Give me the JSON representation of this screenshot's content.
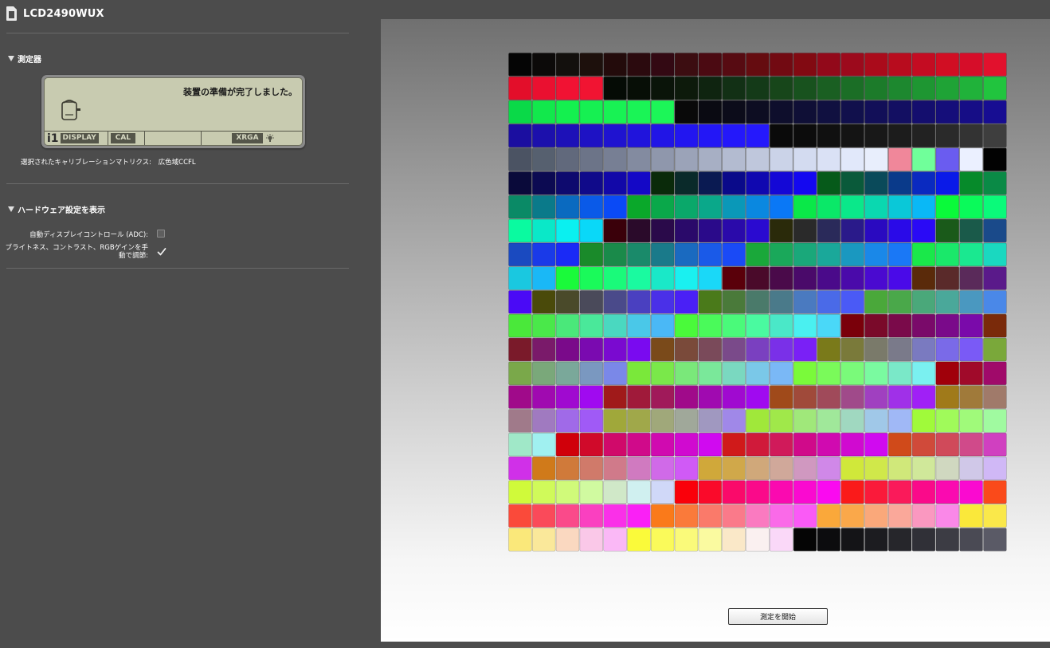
{
  "window": {
    "device_title": "LCD2490WUX"
  },
  "measurement_section": {
    "title": "測定器",
    "lcd": {
      "message": "装置の準備が完了しました。",
      "tab_i1": "i1",
      "tab_display": "DISPLAY",
      "tab_cal": "CAL",
      "tab_xrga": "XRGA"
    },
    "matrix_label": "選択されたキャリブレーションマトリクス:",
    "matrix_value": "広色域CCFL"
  },
  "hardware_section": {
    "title": "ハードウェア設定を表示",
    "ado_label": "自動ディスプレイコントロール (ADC):",
    "ado_checked": false,
    "manual_label_line1": "ブライトネス、コントラスト、RGBゲインを手",
    "manual_label_line2": "動で調節:",
    "manual_checked": true
  },
  "main": {
    "start_button": "測定を開始"
  },
  "colors": {
    "panel_bg": "#4c4c4c",
    "lcd_bg": "#c8cbb0",
    "patch_rows": [
      [
        "#050505",
        "#0c0a09",
        "#13100d",
        "#1d100c",
        "#230b0b",
        "#2b0a0e",
        "#330913",
        "#3c0d11",
        "#4b0a12",
        "#570b12",
        "#650c10",
        "#720a12",
        "#820a12",
        "#92091a",
        "#9c0a1c",
        "#aa0b1b",
        "#b80c1e",
        "#c40c22",
        "#d10e23",
        "#d60d29",
        "#e2112d"
      ],
      [
        "#e30e2a",
        "#ea1030",
        "#f11233",
        "#f11432",
        "#050b05",
        "#070e06",
        "#0a1409",
        "#0d1a0b",
        "#0f2410",
        "#123015",
        "#143a18",
        "#17461a",
        "#18521e",
        "#1a5f22",
        "#1b6e26",
        "#1c7b2a",
        "#1d882f",
        "#1e9632",
        "#1fa336",
        "#20b23a",
        "#21c43e"
      ],
      [
        "#0ad948",
        "#12e84c",
        "#14f04f",
        "#16f052",
        "#18f254",
        "#1af456",
        "#1cf658",
        "#090909",
        "#0a0a12",
        "#0c0c1a",
        "#0d0d22",
        "#0e0e2c",
        "#0f0f36",
        "#101040",
        "#11104c",
        "#120f58",
        "#130f62",
        "#140e6e",
        "#150e7a",
        "#160d86",
        "#170d92"
      ],
      [
        "#1b0ea0",
        "#1c10ac",
        "#1d11b8",
        "#1e12c4",
        "#1f13d0",
        "#2014dc",
        "#2115e6",
        "#2216f0",
        "#2317f6",
        "#2418fa",
        "#2519fc",
        "#0a0a0a",
        "#0c0c0c",
        "#101010",
        "#141414",
        "#181818",
        "#1c1c1c",
        "#222222",
        "#2a2a2a",
        "#333333",
        "#3e3e3e"
      ],
      [
        "#4b5363",
        "#56606f",
        "#61697c",
        "#6c7488",
        "#777f94",
        "#838ba0",
        "#8f97ac",
        "#9ba3b8",
        "#a7afc4",
        "#b3bbd0",
        "#bfc7dc",
        "#cbd3e8",
        "#d3dbf0",
        "#dae1f5",
        "#e1e8fa",
        "#e8eefc",
        "#f0879a",
        "#70ff9a",
        "#6a5cf0",
        "#ebf0ff",
        "#020202"
      ],
      [
        "#0a0a3a",
        "#0c0a52",
        "#0e0a6e",
        "#100a8a",
        "#1208a8",
        "#1408c6",
        "#0a2a0a",
        "#0a2a2a",
        "#0a1a52",
        "#0a0a8a",
        "#1008b0",
        "#1408d6",
        "#1408f0",
        "#065a1a",
        "#0a5a3a",
        "#0a4a5a",
        "#0a3a8a",
        "#0a2ac0",
        "#0a1ae8",
        "#068a2a",
        "#0a8a46"
      ],
      [
        "#0a8a66",
        "#0a7a8a",
        "#0a6ac0",
        "#0a5ae8",
        "#0a4af6",
        "#0aa82a",
        "#0aa84a",
        "#0aa86a",
        "#0aa88a",
        "#0a98b8",
        "#0a88e0",
        "#0a78f6",
        "#0ae848",
        "#0ae868",
        "#0ae88a",
        "#0ad8b0",
        "#0ac8d8",
        "#0ab8f6",
        "#0afa3a",
        "#0afa5a",
        "#0afa7a"
      ],
      [
        "#0afaa0",
        "#0ae8c8",
        "#0af0f0",
        "#0ad8f8",
        "#3a000a",
        "#2a0a2a",
        "#2a0a4a",
        "#2a0a6a",
        "#2a0a8a",
        "#2a0aaa",
        "#2a0ad0",
        "#2a2a0a",
        "#2a2a2a",
        "#2a2a5a",
        "#2a1a8a",
        "#2a0ac0",
        "#2a0ae8",
        "#2a0af6",
        "#1a5a1a",
        "#1a5a4a",
        "#1a4a8a"
      ],
      [
        "#1a4ac0",
        "#1a3ae8",
        "#1a2af6",
        "#1a8a2a",
        "#1a8a4a",
        "#1a8a6a",
        "#1a7a8a",
        "#1a6ac0",
        "#1a5ae8",
        "#1a4af6",
        "#1aa83a",
        "#1aa85a",
        "#1aa87a",
        "#1aa89a",
        "#1a98c0",
        "#1a88e8",
        "#1a78f6",
        "#1ae84a",
        "#1ae86a",
        "#1ae890",
        "#1ad8c0"
      ],
      [
        "#1ac8e0",
        "#1ab8f6",
        "#1afa3a",
        "#1afa5a",
        "#1afa7a",
        "#1afaa0",
        "#1ae8c8",
        "#1af0f0",
        "#1ad8f8",
        "#5a000a",
        "#4a0a2a",
        "#4a0a4a",
        "#4a0a6a",
        "#4a0a8a",
        "#4a0aaa",
        "#4a0ad0",
        "#4a0ae8",
        "#5a2a0a",
        "#5a2a2a",
        "#5a2a5a",
        "#5a1a8a"
      ],
      [
        "#4a0af6",
        "#4a4a0a",
        "#4a4a2a",
        "#4a4a5a",
        "#4a4a8a",
        "#4a40c0",
        "#4a30e8",
        "#4a20f6",
        "#4a7a1a",
        "#4a7a3a",
        "#4a7a6a",
        "#4a7a8a",
        "#4a7ac0",
        "#4a6ae8",
        "#4a5af6",
        "#4aa83a",
        "#4aa84a",
        "#4aa87a",
        "#4aa89a",
        "#4a98c0",
        "#4a88e8"
      ],
      [
        "#4ae83a",
        "#4ae84a",
        "#4ae87a",
        "#4ae89a",
        "#4ad8c0",
        "#4ac8e8",
        "#4ab8f6",
        "#4afa3a",
        "#4afa5a",
        "#4afa7a",
        "#4afaa0",
        "#4ae8c8",
        "#4af0f0",
        "#4ad8f8",
        "#7a000a",
        "#7a0a2a",
        "#7a0a4a",
        "#7a0a6a",
        "#7a0a8a",
        "#7a0aaa",
        "#7a2a0a"
      ],
      [
        "#7a1a2a",
        "#7a1a6a",
        "#7a0a8a",
        "#7a0ab0",
        "#7a0ad0",
        "#7a0af0",
        "#7a4a1a",
        "#7a4a3a",
        "#7a4a5a",
        "#7a4a8a",
        "#7a40c0",
        "#7a30e8",
        "#7a20f6",
        "#7a7a1a",
        "#7a7a3a",
        "#7a7a6a",
        "#7a7a8a",
        "#7a7ac0",
        "#7a6ae8",
        "#7a5af6",
        "#7aa83a"
      ],
      [
        "#7aa84a",
        "#7aa87a",
        "#7aa89a",
        "#7a98c0",
        "#7a88e8",
        "#7ae83a",
        "#7ae84a",
        "#7ae87a",
        "#7ae89a",
        "#7ad8c0",
        "#7ac8e8",
        "#7ab8f6",
        "#7afa3a",
        "#7afa5a",
        "#7afa7a",
        "#7afaa0",
        "#7ae8c8",
        "#7af0f0",
        "#a0000a",
        "#a00a2a",
        "#a00a6a"
      ],
      [
        "#a00a8a",
        "#a00ab0",
        "#a00ad0",
        "#a00af0",
        "#a01a1a",
        "#a01a3a",
        "#a01a5a",
        "#a00a8a",
        "#a00ab0",
        "#a00ad0",
        "#a00af0",
        "#a04a1a",
        "#a04a3a",
        "#a04a5a",
        "#a04a8a",
        "#a040c0",
        "#a030e8",
        "#a020f6",
        "#a07a1a",
        "#a07a3a",
        "#a07a6a"
      ],
      [
        "#a07a8a",
        "#a07ac0",
        "#a06ae8",
        "#a05af6",
        "#a0a83a",
        "#a0a84a",
        "#a0a87a",
        "#a0a89a",
        "#a098c0",
        "#a088e8",
        "#a0e83a",
        "#a0e84a",
        "#a0e87a",
        "#a0e89a",
        "#a0d8c0",
        "#a0c8e8",
        "#a0b8f6",
        "#a0fa3a",
        "#a0fa5a",
        "#a0fa7a",
        "#a0faa0"
      ],
      [
        "#a0e8c8",
        "#a0f0f0",
        "#d0000a",
        "#d00a2a",
        "#d00a6a",
        "#d00a8a",
        "#d00ab0",
        "#d00ad0",
        "#d00af0",
        "#d01a1a",
        "#d01a3a",
        "#d01a5a",
        "#d00a8a",
        "#d00ab0",
        "#d00ad0",
        "#d00af0",
        "#d04a1a",
        "#d04a3a",
        "#d04a5a",
        "#d04a8a",
        "#d040c0"
      ],
      [
        "#d030e8",
        "#d07a1a",
        "#d07a3a",
        "#d07a6a",
        "#d07a8a",
        "#d07ac0",
        "#d06ae8",
        "#d05af6",
        "#d0a83a",
        "#d0a84a",
        "#d0a87a",
        "#d0a89a",
        "#d098c0",
        "#d088e8",
        "#d0e83a",
        "#d0e84a",
        "#d0e87a",
        "#d0e89a",
        "#d0d8c0",
        "#d0c8e8",
        "#d0b8f6"
      ],
      [
        "#d0fa3a",
        "#d0fa5a",
        "#d0fa7a",
        "#d0faa0",
        "#d0e8c8",
        "#d0f0f0",
        "#d0d8f8",
        "#fa000a",
        "#fa0a2a",
        "#fa0a6a",
        "#fa0a8a",
        "#fa0ab0",
        "#fa0ad0",
        "#fa0af0",
        "#fa1a1a",
        "#fa1a3a",
        "#fa1a5a",
        "#fa0a8a",
        "#fa0ab0",
        "#fa0ad0",
        "#fa4a1a"
      ],
      [
        "#fa4a3a",
        "#fa4a5a",
        "#fa4a8a",
        "#fa40c0",
        "#fa30e8",
        "#fa20f6",
        "#fa7a1a",
        "#fa7a3a",
        "#fa7a6a",
        "#fa7a8a",
        "#fa7ac0",
        "#fa6ae8",
        "#fa5af6",
        "#faa83a",
        "#faa84a",
        "#faa87a",
        "#faa89a",
        "#fa98c0",
        "#fa88e8",
        "#fae83a",
        "#fae84a"
      ],
      [
        "#fae87a",
        "#fae89a",
        "#fad8c0",
        "#fac8e8",
        "#fab8f6",
        "#fafa3a",
        "#fafa5a",
        "#fafa7a",
        "#fafaa0",
        "#fae8c8",
        "#faf0f0",
        "#fad8f8",
        "#050505",
        "#0c0c0e",
        "#141417",
        "#1c1c20",
        "#26262b",
        "#303037",
        "#3c3c44",
        "#4a4a54",
        "#5a5a66"
      ]
    ]
  }
}
